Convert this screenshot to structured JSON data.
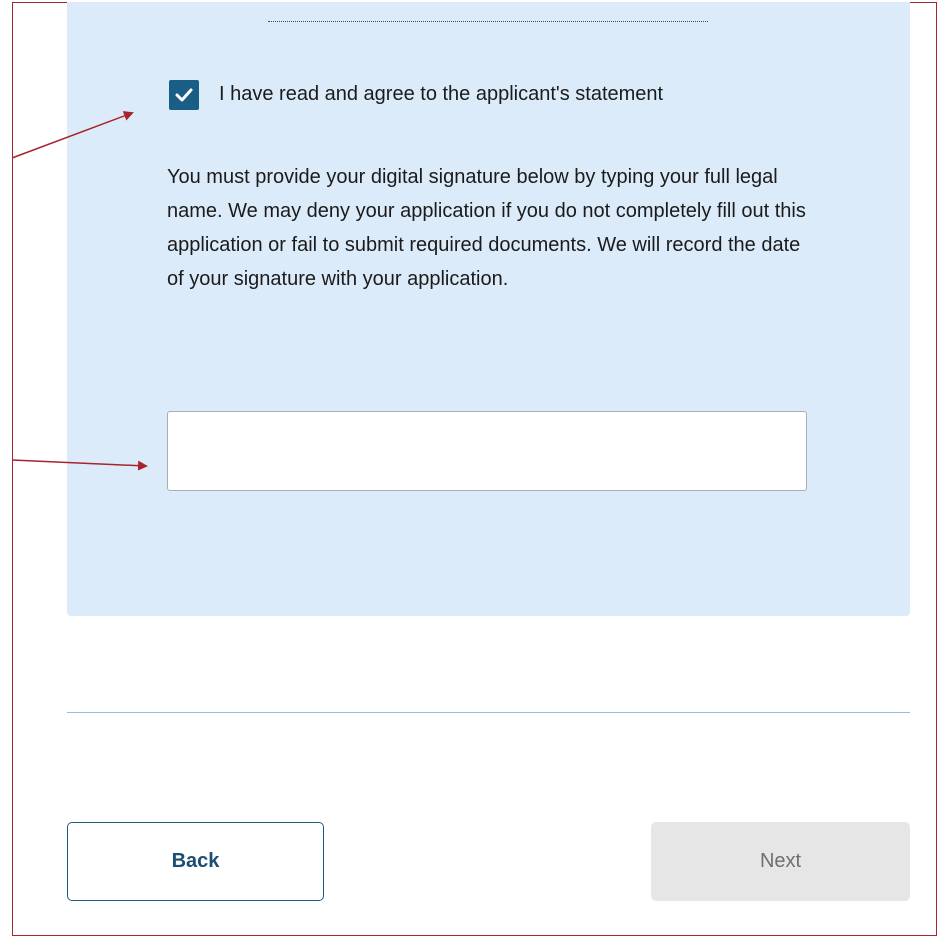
{
  "statement_section": {
    "agree_checkbox": {
      "checked": true,
      "label": "I have read and agree to the applicant's statement"
    },
    "instructions": "You must provide your digital signature below by typing your full legal name. We may deny your application if you do not completely fill out this application or fail to submit required documents. We will record the date of your signature with your application.",
    "signature_field": {
      "value": "",
      "placeholder": ""
    }
  },
  "navigation": {
    "back_label": "Back",
    "next_label": "Next"
  },
  "colors": {
    "panel_background": "#dcebfa",
    "primary": "#1a5e85",
    "annotation_arrow": "#a8242c",
    "disabled_button": "#e6e6e6"
  },
  "icons": {
    "checkbox_mark": "checkmark-icon"
  }
}
